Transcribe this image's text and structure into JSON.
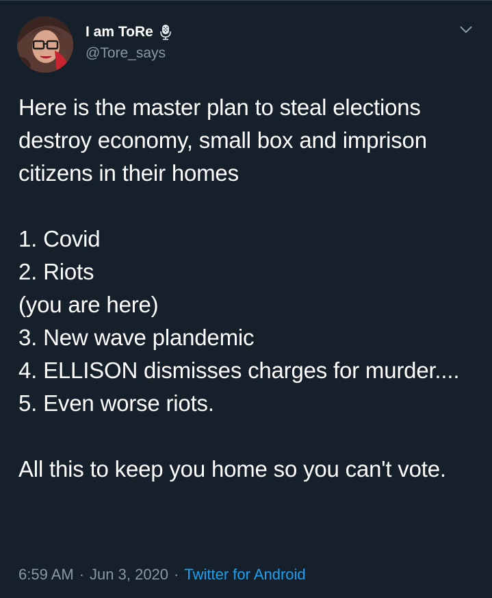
{
  "tweet": {
    "display_name": "I am ToRe",
    "handle": "@Tore_says",
    "text": "Here is the master plan to steal elections destroy economy, small box and imprison citizens in their homes\n\n1. Covid\n2. Riots\n(you are here)\n3. New wave plandemic\n4. ELLISON dismisses charges for murder....\n5. Even worse riots.\n\nAll this to keep you home so you can't vote.",
    "time": "6:59 AM",
    "date": "Jun 3, 2020",
    "source": "Twitter for Android",
    "separator": "·"
  },
  "icons": {
    "name_badge": "microphone-icon",
    "menu": "chevron-down-icon"
  },
  "colors": {
    "background": "#15202b",
    "text": "#ffffff",
    "secondary": "#8899a6",
    "link": "#1da1f2"
  }
}
